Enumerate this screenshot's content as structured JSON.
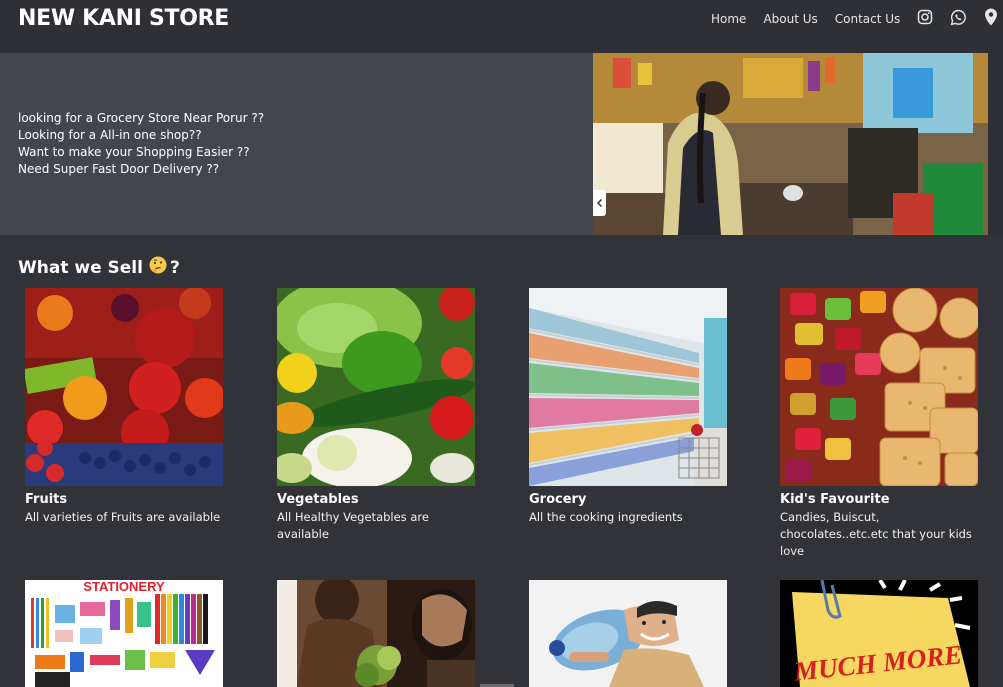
{
  "header": {
    "brand": "NEW KANI STORE",
    "nav": [
      {
        "label": "Home"
      },
      {
        "label": "About Us"
      },
      {
        "label": "Contact Us"
      }
    ],
    "icons": [
      "instagram-icon",
      "whatsapp-icon",
      "location-pin-icon"
    ]
  },
  "hero": {
    "lines": [
      "looking for a Grocery Store Near Porur ??",
      "Looking for a All-in one shop??",
      "Want to make your Shopping Easier ??",
      "Need Super Fast Door Delivery ??"
    ]
  },
  "section": {
    "title": "What we Sell",
    "suffix": "?"
  },
  "products": [
    {
      "name": "Fruits",
      "desc": "All varieties of Fruits are available"
    },
    {
      "name": "Vegetables",
      "desc": "All Healthy Vegetables are available"
    },
    {
      "name": "Grocery",
      "desc": "All the cooking ingredients"
    },
    {
      "name": "Kid's Favourite",
      "desc": "Candies, Buiscut, chocolates..etc.etc that your kids love"
    }
  ],
  "second_row": {
    "stationery_label": "STATIONERY",
    "much_more_label": "MUCH MORE"
  },
  "colors": {
    "background": "#323338",
    "header": "#2f3035",
    "hero": "#43474d"
  }
}
